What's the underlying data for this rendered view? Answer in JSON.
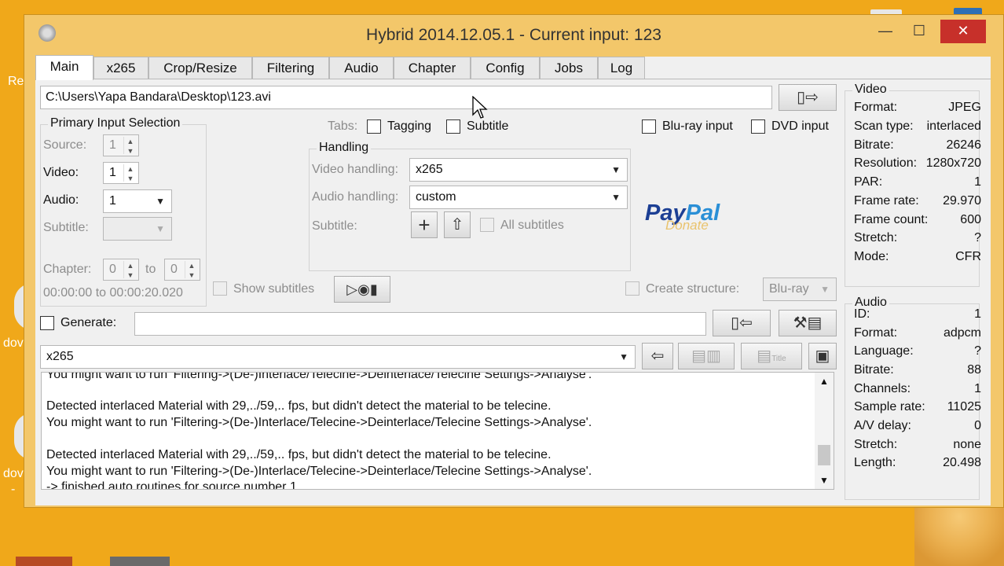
{
  "window": {
    "title": "Hybrid 2014.12.05.1 - Current input: 123",
    "minimize": "—",
    "maximize": "☐",
    "close": "✕"
  },
  "desktop": {
    "labels": [
      "Re",
      "dov",
      "dov",
      "-"
    ]
  },
  "tabs": [
    "Main",
    "x265",
    "Crop/Resize",
    "Filtering",
    "Audio",
    "Chapter",
    "Config",
    "Jobs",
    "Log"
  ],
  "input": {
    "path": "C:\\Users\\Yapa Bandara\\Desktop\\123.avi"
  },
  "primary": {
    "title": "Primary Input Selection",
    "source_label": "Source:",
    "source_value": "1",
    "video_label": "Video:",
    "video_value": "1",
    "audio_label": "Audio:",
    "audio_value": "1",
    "subtitle_label": "Subtitle:",
    "subtitle_value": "",
    "chapter_label": "Chapter:",
    "chapter_from": "0",
    "to_label": "to",
    "chapter_to": "0",
    "time_range": "00:00:00 to 00:00:20.020"
  },
  "tabs_opts": {
    "label": "Tabs:",
    "tagging": "Tagging",
    "subtitle": "Subtitle"
  },
  "flags": {
    "bluray_input": "Blu-ray input",
    "dvd_input": "DVD input"
  },
  "handling": {
    "title": "Handling",
    "video_label": "Video handling:",
    "video_value": "x265",
    "audio_label": "Audio handling:",
    "audio_value": "custom",
    "subtitle_label": "Subtitle:",
    "all_subtitles": "All subtitles"
  },
  "paypal": {
    "logo": "PayPal",
    "sub": "Donate"
  },
  "show_subtitles": "Show subtitles",
  "create_structure": {
    "label": "Create structure:",
    "value": "Blu-ray"
  },
  "generate": {
    "label": "Generate:",
    "value": ""
  },
  "job_profile": {
    "value": "x265"
  },
  "log": {
    "lines": [
      "You might want to run 'Filtering->(De-)Interlace/Telecine->Deinterlace/Telecine Settings->Analyse'.",
      "",
      " Detected interlaced Material with 29,../59,.. fps, but didn't detect the material to be telecine.",
      "You might want to run 'Filtering->(De-)Interlace/Telecine->Deinterlace/Telecine Settings->Analyse'.",
      "",
      " Detected interlaced Material with 29,../59,.. fps, but didn't detect the material to be telecine.",
      "You might want to run 'Filtering->(De-)Interlace/Telecine->Deinterlace/Telecine Settings->Analyse'.",
      " -> finished auto routines for source number 1."
    ]
  },
  "video_info": {
    "title": "Video",
    "rows": [
      {
        "k": "Format:",
        "v": "JPEG"
      },
      {
        "k": "Scan type:",
        "v": "interlaced"
      },
      {
        "k": "Bitrate:",
        "v": "26246"
      },
      {
        "k": "Resolution:",
        "v": "1280x720"
      },
      {
        "k": "PAR:",
        "v": "1"
      },
      {
        "k": "Frame rate:",
        "v": "29.970"
      },
      {
        "k": "Frame count:",
        "v": "600"
      },
      {
        "k": "Stretch:",
        "v": "?"
      },
      {
        "k": "Mode:",
        "v": "CFR"
      }
    ]
  },
  "audio_info": {
    "title": "Audio",
    "rows": [
      {
        "k": "ID:",
        "v": "1"
      },
      {
        "k": "Format:",
        "v": "adpcm"
      },
      {
        "k": "Language:",
        "v": "?"
      },
      {
        "k": "Bitrate:",
        "v": "88"
      },
      {
        "k": "Channels:",
        "v": "1"
      },
      {
        "k": "Sample rate:",
        "v": "11025"
      },
      {
        "k": "A/V delay:",
        "v": "0"
      },
      {
        "k": "Stretch:",
        "v": "none"
      },
      {
        "k": "Length:",
        "v": "20.498"
      }
    ]
  },
  "buttons": {
    "title_label": "Title"
  },
  "colors": {
    "desktop": "#f0a81a",
    "close": "#c7302a",
    "paypal_dark": "#1c3f94",
    "paypal_light": "#2a8fd6"
  }
}
